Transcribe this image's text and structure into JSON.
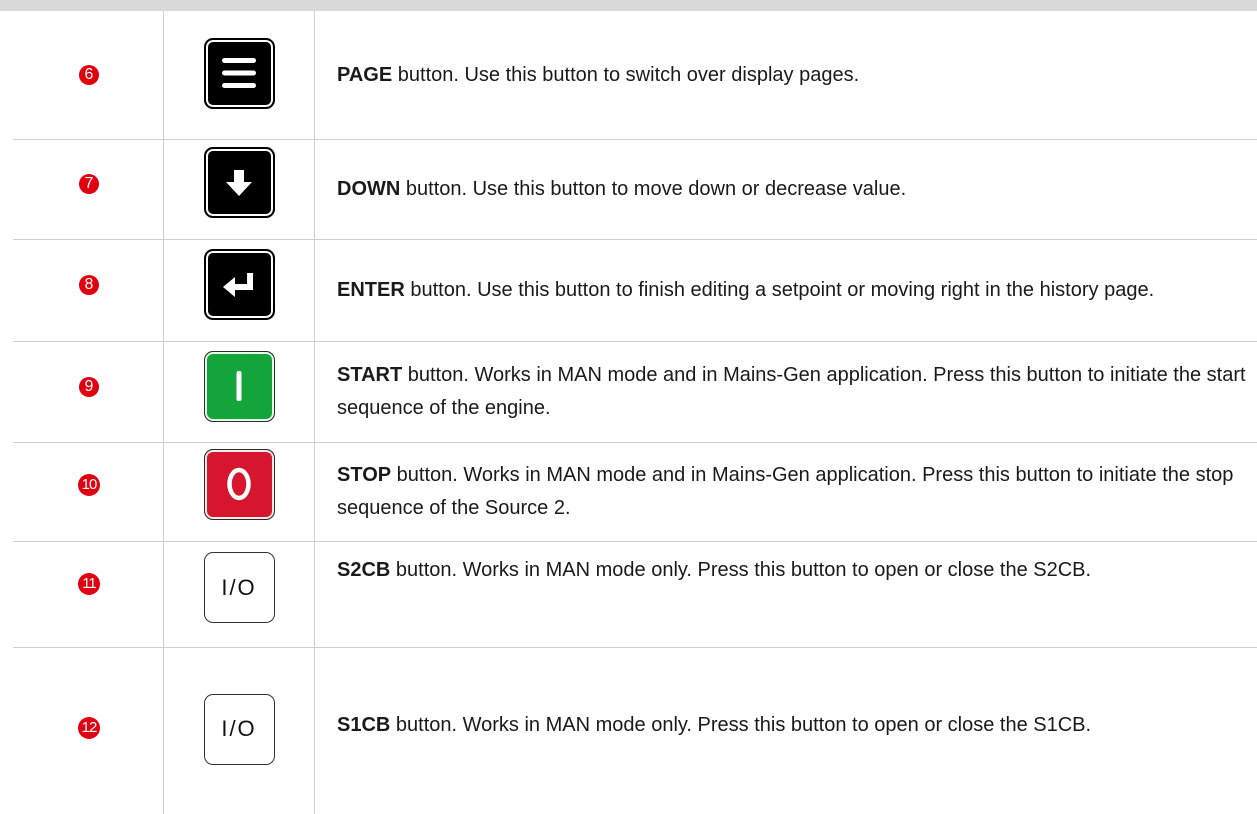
{
  "rows": [
    {
      "number": "6",
      "key_label": "",
      "key_icon": "menu-icon",
      "bold": "PAGE",
      "text": " button. Use this button to switch over display pages."
    },
    {
      "number": "7",
      "key_label": "",
      "key_icon": "arrow-down-icon",
      "bold": "DOWN",
      "text": " button. Use this button to move down or decrease value."
    },
    {
      "number": "8",
      "key_label": "",
      "key_icon": "enter-icon",
      "bold": "ENTER",
      "text": " button. Use this button to finish editing a setpoint or moving right in the history page."
    },
    {
      "number": "9",
      "key_label": "",
      "key_icon": "start-icon",
      "bold": "START",
      "text": " button. Works in MAN mode and in Mains-Gen application. Press this button to initiate the start sequence of the engine."
    },
    {
      "number": "10",
      "key_label": "",
      "key_icon": "stop-icon",
      "bold": "STOP",
      "text": " button. Works in MAN mode and in Mains-Gen application. Press this button to initiate the stop sequence of the Source 2."
    },
    {
      "number": "11",
      "key_label": "I/O",
      "key_icon": "breaker-toggle-icon",
      "bold": "S2CB",
      "text": " button. Works in MAN mode only. Press this button to open or close the S2CB."
    },
    {
      "number": "12",
      "key_label": "I/O",
      "key_icon": "breaker-toggle-icon",
      "bold": "S1CB",
      "text": " button. Works in MAN mode only. Press this button to open or close the S1CB."
    }
  ],
  "colors": {
    "badge": "#e0000f",
    "start": "#13a53b",
    "stop": "#d6162f",
    "dark_key": "#000000"
  }
}
